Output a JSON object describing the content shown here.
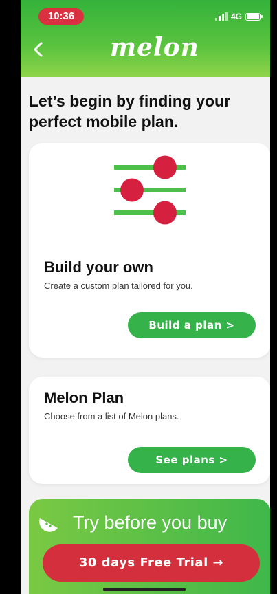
{
  "status_bar": {
    "time": "10:36",
    "network": "4G"
  },
  "header": {
    "back_icon": "chevron-left-icon",
    "logo_text": "melon"
  },
  "page_title": "Let’s begin by finding your perfect mobile plan.",
  "build_card": {
    "icon": "sliders-icon",
    "title": "Build your own",
    "description": "Create a custom plan tailored for you.",
    "button_label": "Build a plan >"
  },
  "melon_card": {
    "title": "Melon Plan",
    "description": "Choose from a list of Melon plans.",
    "button_label": "See plans >"
  },
  "trial": {
    "icon": "melon-slice-icon",
    "heading": "Try before you buy",
    "button_label": "30 days Free Trial →"
  },
  "colors": {
    "brand_green": "#35b34a",
    "accent_red": "#d32f3d",
    "background": "#f2f2f2"
  }
}
